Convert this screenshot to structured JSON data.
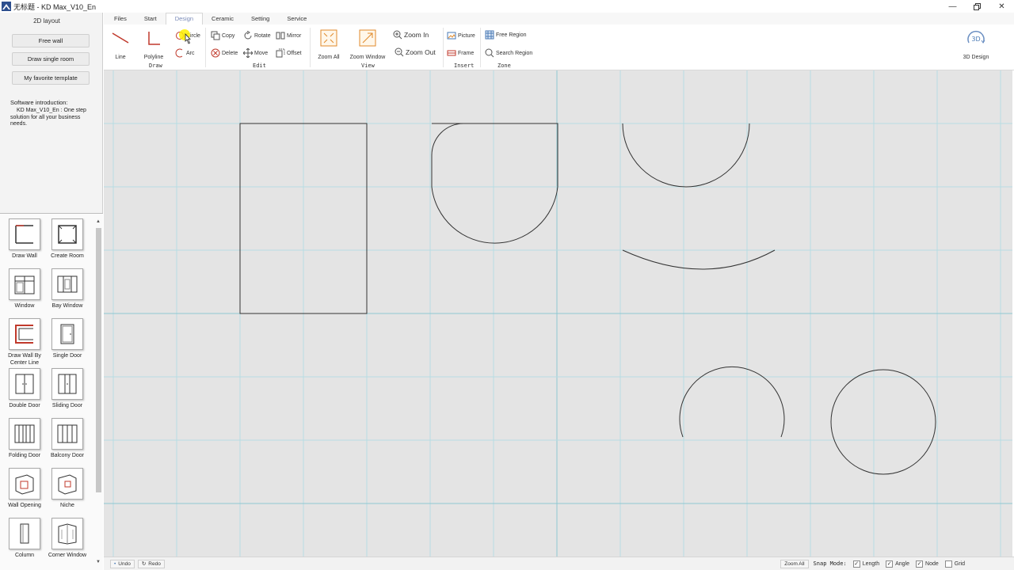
{
  "window": {
    "title": "无标题 - KD Max_V10_En",
    "controls": [
      "minimize-icon",
      "restore-icon",
      "close-icon"
    ]
  },
  "sidebar": {
    "title": "2D layout",
    "buttons": [
      "Free wall",
      "Draw single room",
      "My favorite template"
    ],
    "intro_heading": "Software introduction:",
    "intro_lines": [
      "KD Max_V10_En : One step",
      "solution for all your business",
      "needs."
    ]
  },
  "tools": [
    {
      "label": "Draw Wall",
      "icon": "draw-wall-icon"
    },
    {
      "label": "Create Room",
      "icon": "create-room-icon"
    },
    {
      "label": "Window",
      "icon": "window-icon"
    },
    {
      "label": "Bay Window",
      "icon": "bay-window-icon"
    },
    {
      "label": "Draw Wall By Center Line",
      "icon": "draw-wall-center-line-icon"
    },
    {
      "label": "Single Door",
      "icon": "single-door-icon"
    },
    {
      "label": "Double Door",
      "icon": "double-door-icon"
    },
    {
      "label": "Sliding Door",
      "icon": "sliding-door-icon"
    },
    {
      "label": "Folding Door",
      "icon": "folding-door-icon"
    },
    {
      "label": "Balcony Door",
      "icon": "balcony-door-icon"
    },
    {
      "label": "Wall Opening",
      "icon": "wall-opening-icon"
    },
    {
      "label": "Niche",
      "icon": "niche-icon"
    },
    {
      "label": "Column",
      "icon": "column-icon"
    },
    {
      "label": "Corner Window",
      "icon": "corner-window-icon"
    }
  ],
  "ribbon": {
    "tabs": [
      "Files",
      "Start",
      "Design",
      "Ceramic",
      "Setting",
      "Service"
    ],
    "active_tab": "Design",
    "draw": {
      "line": "Line",
      "polyline": "Polyline",
      "circle": "Circle",
      "arc": "Arc",
      "group": "Draw"
    },
    "edit": {
      "copy": "Copy",
      "rotate": "Rotate",
      "mirror": "Mirror",
      "delete": "Delete",
      "move": "Move",
      "offset": "Offset",
      "group": "Edit"
    },
    "view": {
      "zoom_all": "Zoom All",
      "zoom_window": "Zoom Window",
      "zoom_in": "Zoom In",
      "zoom_out": "Zoom Out",
      "group": "View"
    },
    "insert": {
      "picture": "Picture",
      "frame": "Frame",
      "group": "Insert"
    },
    "zone": {
      "free_region": "Free Region",
      "search_region": "Search Region",
      "group": "Zone"
    },
    "design3d": {
      "label": "3D Design",
      "badge": "3D"
    }
  },
  "statusbar": {
    "undo": "Undo",
    "redo": "Redo",
    "zoom_all": "Zoom All",
    "snap_mode": "Snap Mode:",
    "checks": [
      {
        "label": "Length",
        "checked": true
      },
      {
        "label": "Angle",
        "checked": true
      },
      {
        "label": "Node",
        "checked": true
      },
      {
        "label": "Grid",
        "checked": false
      }
    ]
  },
  "colors": {
    "canvas_bg": "#e4e4e4",
    "grid_line": "#b7dde3",
    "axis_line": "#8fc8d2",
    "shape_stroke": "#333333",
    "accent_red": "#c0392b",
    "accent_blue": "#4a7ab5"
  }
}
